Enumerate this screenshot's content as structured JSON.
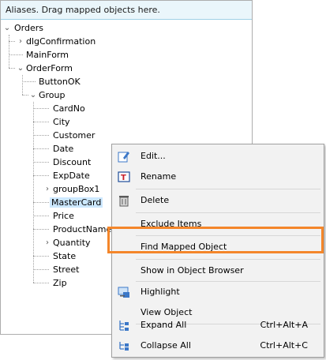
{
  "panel": {
    "hint": "Aliases. Drag mapped objects here."
  },
  "tree": {
    "nodes": [
      {
        "label": "Orders"
      },
      {
        "label": "dlgConfirmation"
      },
      {
        "label": "MainForm"
      },
      {
        "label": "OrderForm"
      },
      {
        "label": "ButtonOK"
      },
      {
        "label": "Group"
      },
      {
        "label": "CardNo"
      },
      {
        "label": "City"
      },
      {
        "label": "Customer"
      },
      {
        "label": "Date"
      },
      {
        "label": "Discount"
      },
      {
        "label": "ExpDate"
      },
      {
        "label": "groupBox1"
      },
      {
        "label": "MasterCard"
      },
      {
        "label": "Price"
      },
      {
        "label": "ProductNames"
      },
      {
        "label": "Quantity"
      },
      {
        "label": "State"
      },
      {
        "label": "Street"
      },
      {
        "label": "Zip"
      }
    ]
  },
  "menu": {
    "items": [
      {
        "label": "Edit...",
        "icon": "edit-icon"
      },
      {
        "label": "Rename",
        "icon": "rename-icon"
      },
      {
        "label": "Delete",
        "icon": "delete-icon"
      },
      {
        "label": "Exclude Items",
        "icon": ""
      },
      {
        "label": "Find Mapped Object",
        "icon": ""
      },
      {
        "label": "Show in Object Browser",
        "icon": ""
      },
      {
        "label": "Highlight",
        "icon": "highlight-icon"
      },
      {
        "label": "View Object",
        "icon": ""
      },
      {
        "label": "Expand All",
        "icon": "expand-all-icon",
        "shortcut": "Ctrl+Alt+A"
      },
      {
        "label": "Collapse All",
        "icon": "collapse-all-icon",
        "shortcut": "Ctrl+Alt+C"
      }
    ]
  },
  "colors": {
    "highlight_border": "#f4862a",
    "selection": "#cce8ff",
    "hint_background": "#eaf6fb"
  }
}
